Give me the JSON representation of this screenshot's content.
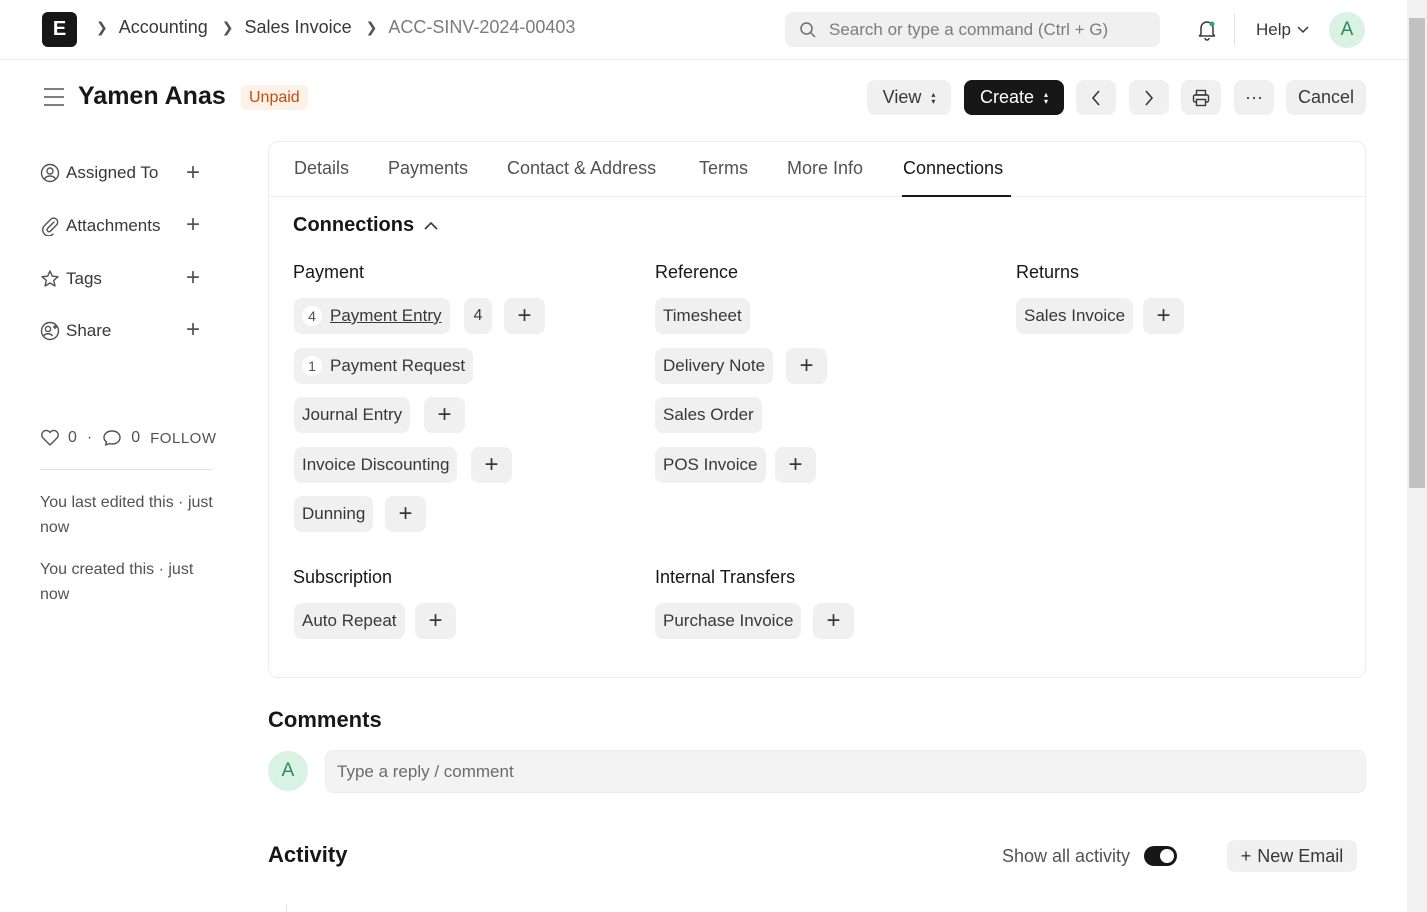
{
  "navbar": {
    "logo_letter": "E",
    "breadcrumbs": [
      "Accounting",
      "Sales Invoice",
      "ACC-SINV-2024-00403"
    ],
    "search_placeholder": "Search or type a command (Ctrl + G)",
    "help_label": "Help",
    "avatar_letter": "A"
  },
  "header": {
    "title": "Yamen Anas",
    "status": "Unpaid",
    "view_label": "View",
    "create_label": "Create",
    "more_label": "···",
    "cancel_label": "Cancel"
  },
  "sidebar": {
    "items": [
      {
        "label": "Assigned To",
        "icon": "assign-icon"
      },
      {
        "label": "Attachments",
        "icon": "paperclip-icon"
      },
      {
        "label": "Tags",
        "icon": "star-icon"
      },
      {
        "label": "Share",
        "icon": "share-icon"
      }
    ],
    "likes": "0",
    "comments": "0",
    "follow": "FOLLOW",
    "last_edited": "You last edited this · just now",
    "created": "You created this · just now"
  },
  "tabs": [
    "Details",
    "Payments",
    "Contact & Address",
    "Terms",
    "More Info",
    "Connections"
  ],
  "active_tab": "Connections",
  "connections": {
    "title": "Connections",
    "groups": {
      "payment": {
        "label": "Payment",
        "items": [
          {
            "label": "Payment Entry",
            "count": "4",
            "badge": "4"
          },
          {
            "label": "Payment Request",
            "count": "1"
          },
          {
            "label": "Journal Entry"
          },
          {
            "label": "Invoice Discounting"
          },
          {
            "label": "Dunning"
          }
        ]
      },
      "reference": {
        "label": "Reference",
        "items": [
          {
            "label": "Timesheet"
          },
          {
            "label": "Delivery Note"
          },
          {
            "label": "Sales Order"
          },
          {
            "label": "POS Invoice"
          }
        ]
      },
      "returns": {
        "label": "Returns",
        "items": [
          {
            "label": "Sales Invoice"
          }
        ]
      },
      "subscription": {
        "label": "Subscription",
        "items": [
          {
            "label": "Auto Repeat"
          }
        ]
      },
      "internal_transfers": {
        "label": "Internal Transfers",
        "items": [
          {
            "label": "Purchase Invoice"
          }
        ]
      }
    }
  },
  "comments": {
    "title": "Comments",
    "avatar_letter": "A",
    "placeholder": "Type a reply / comment"
  },
  "activity": {
    "title": "Activity",
    "show_all_label": "Show all activity",
    "show_all_on": true,
    "new_email_label": "New Email"
  },
  "colors": {
    "accent": "#171717",
    "status_unpaid_bg": "#fdf1e8",
    "status_unpaid_text": "#c14e0f",
    "avatar_bg": "#d9f2e4"
  }
}
